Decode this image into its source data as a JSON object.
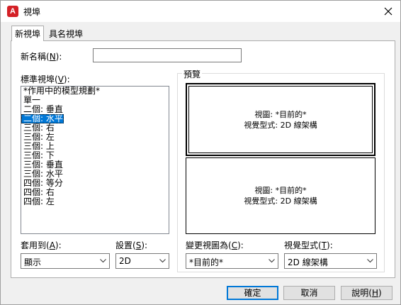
{
  "window": {
    "title": "視埠",
    "app_icon_letter": "A"
  },
  "tabs": [
    {
      "label": "新視埠"
    },
    {
      "label": "具名視埠"
    }
  ],
  "new_name": {
    "label_prefix": "新名稱(",
    "label_key": "N",
    "label_suffix": "):",
    "value": ""
  },
  "standard_viewports": {
    "label_prefix": "標準視埠(",
    "label_key": "V",
    "label_suffix": "):",
    "items": [
      "*作用中的模型規劃*",
      "單一",
      "二個: 垂直",
      "二個: 水平",
      "三個: 右",
      "三個: 左",
      "三個: 上",
      "三個: 下",
      "三個: 垂直",
      "三個: 水平",
      "四個: 等分",
      "四個: 右",
      "四個: 左"
    ],
    "selected_index": 3
  },
  "preview": {
    "title": "預覽",
    "panes": [
      {
        "line1": "視圖: *目前的*",
        "line2": "視覺型式: 2D 線架構"
      },
      {
        "line1": "視圖: *目前的*",
        "line2": "視覺型式: 2D 線架構"
      }
    ]
  },
  "apply_to": {
    "label_prefix": "套用到(",
    "label_key": "A",
    "label_suffix": "):",
    "value": "顯示"
  },
  "setup": {
    "label_prefix": "設置(",
    "label_key": "S",
    "label_suffix": "):",
    "value": "2D"
  },
  "change_view": {
    "label_prefix": "變更視圖為(",
    "label_key": "C",
    "label_suffix": "):",
    "value": "*目前的*"
  },
  "visual_style": {
    "label_prefix": "視覺型式(",
    "label_key": "T",
    "label_suffix": "):",
    "value": "2D 線架構"
  },
  "buttons": {
    "ok": "確定",
    "cancel": "取消",
    "help_prefix": "說明(",
    "help_key": "H",
    "help_suffix": ")"
  },
  "colors": {
    "accent": "#0078d7",
    "app_icon": "#d42026"
  }
}
